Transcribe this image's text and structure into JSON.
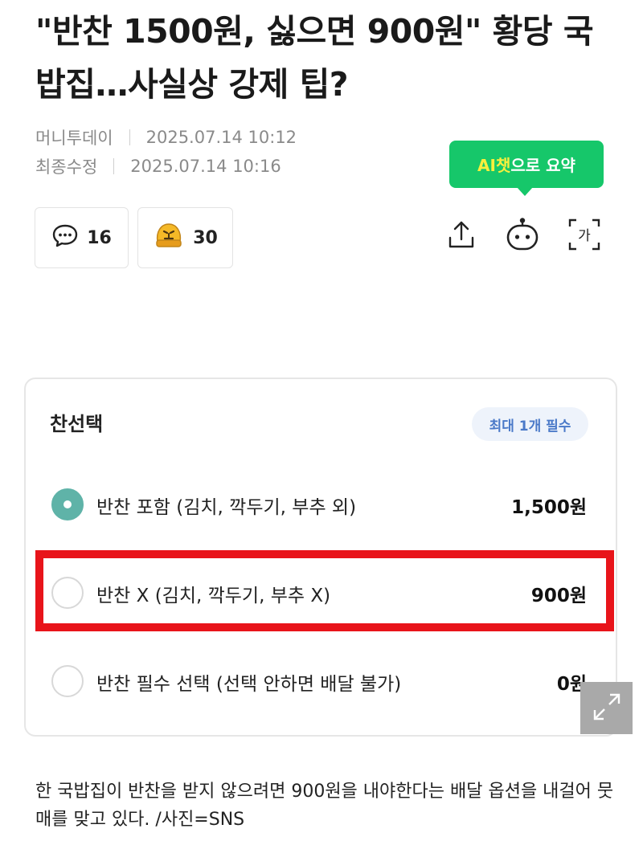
{
  "article": {
    "title": "\"반찬 1500원, 싫으면 900원\" 황당 국밥집…사실상 강제 팁?",
    "source": "머니투데이",
    "published": "2025.07.14 10:12",
    "modified_label": "최종수정",
    "modified": "2025.07.14 10:16"
  },
  "ai_summary": {
    "prefix": "AI챗",
    "suffix": "으로 요약"
  },
  "reactions": {
    "comments_count": "16",
    "emoji_count": "30"
  },
  "toolbar": {
    "share_icon": "share-icon",
    "bot_icon": "ai-bot-icon",
    "font_size_label": "가"
  },
  "image": {
    "section_title": "찬선택",
    "badge": "최대 1개 필수",
    "options": [
      {
        "label": "반찬 포함 (김치, 깍두기, 부추 외)",
        "price": "1,500원",
        "selected": true
      },
      {
        "label": "반찬 X (김치, 깍두기, 부추 X)",
        "price": "900원",
        "selected": false
      },
      {
        "label": "반찬 필수 선택 (선택 안하면 배달 불가)",
        "price": "0원",
        "selected": false
      }
    ],
    "highlight_color": "#e8141a",
    "accent_color": "#5fb3a8"
  },
  "caption": "한 국밥집이 반찬을 받지 않으려면 900원을 내야한다는 배달 옵션을 내걸어 뭇매를 맞고 있다. /사진=SNS",
  "colors": {
    "ai_green": "#16c76a",
    "ai_yellow": "#f8ef3c",
    "badge_blue": "#4a79c8"
  }
}
